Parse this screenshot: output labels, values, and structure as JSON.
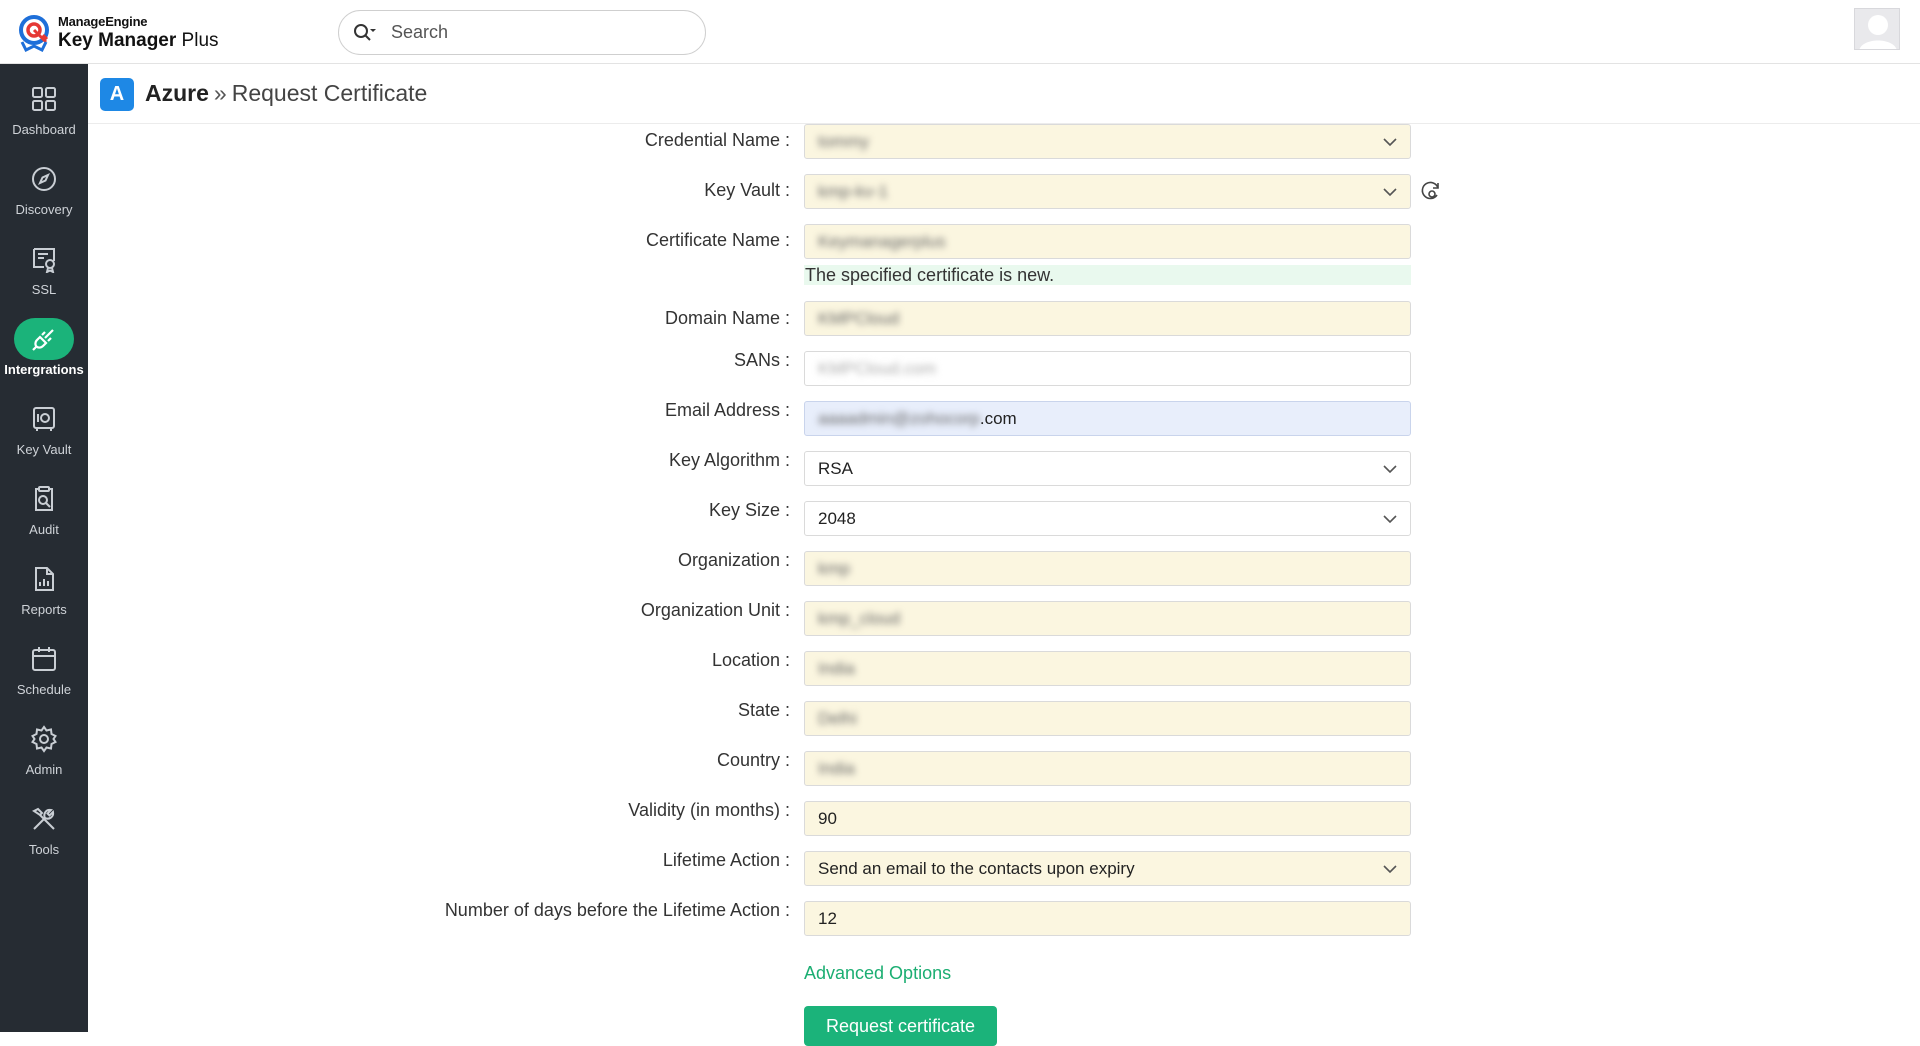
{
  "app": {
    "brand": "ManageEngine",
    "product_bold": "Key Manager",
    "product_rest": " Plus"
  },
  "search": {
    "placeholder": "Search"
  },
  "sidebar": {
    "items": [
      {
        "label": "Dashboard",
        "icon": "dashboard-icon"
      },
      {
        "label": "Discovery",
        "icon": "compass-icon"
      },
      {
        "label": "SSL",
        "icon": "certificate-icon"
      },
      {
        "label": "Intergrations",
        "icon": "plug-icon",
        "active": true
      },
      {
        "label": "Key Vault",
        "icon": "vault-icon"
      },
      {
        "label": "Audit",
        "icon": "audit-icon"
      },
      {
        "label": "Reports",
        "icon": "report-icon"
      },
      {
        "label": "Schedule",
        "icon": "calendar-icon"
      },
      {
        "label": "Admin",
        "icon": "gear-icon"
      },
      {
        "label": "Tools",
        "icon": "tools-icon"
      }
    ]
  },
  "header": {
    "badge": "A",
    "crumb": "Azure",
    "separator": "»",
    "current": "Request Certificate"
  },
  "form": {
    "credential_name": {
      "label": "Credential Name :",
      "value": "tommy"
    },
    "key_vault": {
      "label": "Key Vault :",
      "value": "kmp-kv-1"
    },
    "certificate_name": {
      "label": "Certificate Name :",
      "value": "Keymanagerplus",
      "hint": "The specified certificate is new."
    },
    "domain_name": {
      "label": "Domain Name :",
      "value": "KMPCloud"
    },
    "sans": {
      "label": "SANs :",
      "placeholder": "KMPCloud.com"
    },
    "email": {
      "label": "Email Address :",
      "value_hidden": "aaaadmin@zohocorp",
      "value_visible": ".com"
    },
    "key_algorithm": {
      "label": "Key Algorithm :",
      "value": "RSA"
    },
    "key_size": {
      "label": "Key Size :",
      "value": "2048"
    },
    "organization": {
      "label": "Organization :",
      "value": "kmp"
    },
    "organization_unit": {
      "label": "Organization Unit :",
      "value": "kmp_cloud"
    },
    "location": {
      "label": "Location :",
      "value": "India"
    },
    "state": {
      "label": "State :",
      "value": "Delhi"
    },
    "country": {
      "label": "Country :",
      "value": "India"
    },
    "validity": {
      "label": "Validity (in months) :",
      "value": "90"
    },
    "lifetime_action": {
      "label": "Lifetime Action :",
      "value": "Send an email to the contacts upon expiry"
    },
    "days_before": {
      "label": "Number of days before the Lifetime Action :",
      "value": "12"
    }
  },
  "advanced_options": "Advanced Options",
  "submit_label": "Request certificate",
  "colors": {
    "accent": "#1bb37a",
    "sidebar_bg": "#262c33",
    "field_bg": "#fbf6e0",
    "azure": "#1e88e5"
  }
}
